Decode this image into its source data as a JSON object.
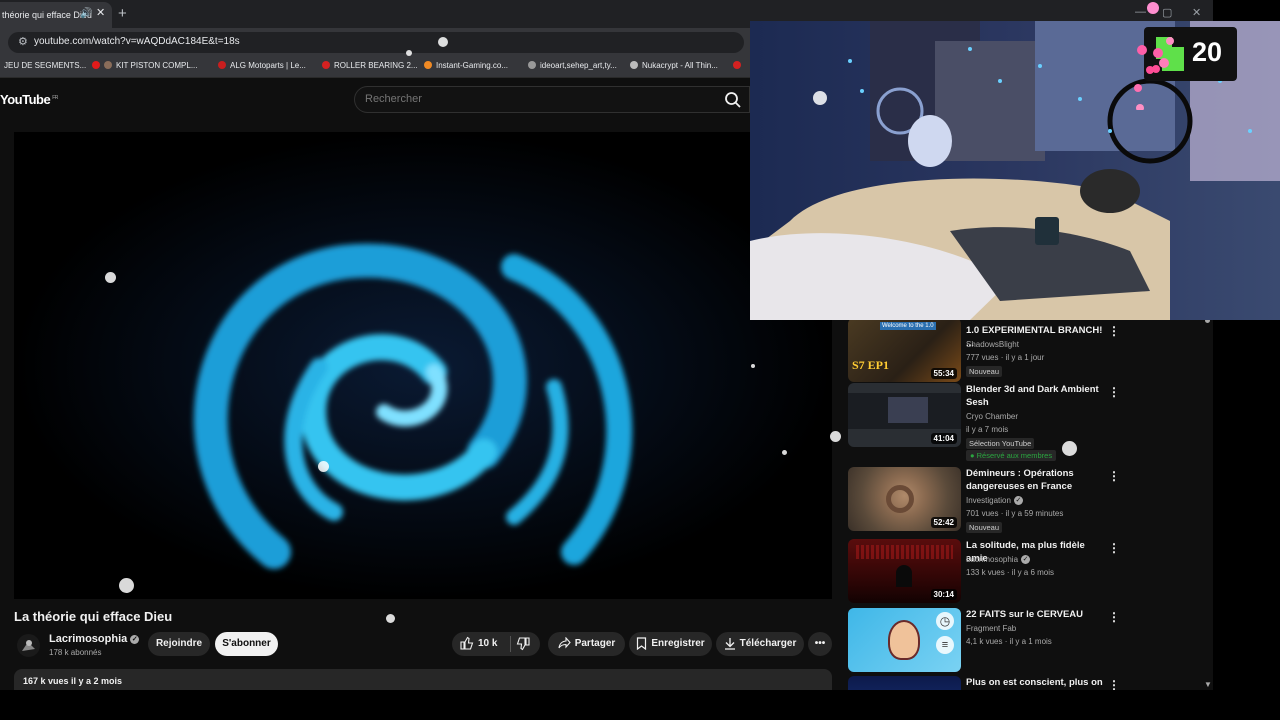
{
  "browser": {
    "tab_title": "théorie qui efface Dieu",
    "url": "youtube.com/watch?v=wAQDdAC184E&t=18s",
    "bookmarks": [
      "JEU DE SEGMENTS...",
      "KIT PISTON COMPL...",
      "ALG Motoparts | Le...",
      "ROLLER BEARING 2...",
      "Instant-Gaming.co...",
      "ideoart,sehep_art,ty...",
      "Nukacrypt - All Thin..."
    ]
  },
  "youtube": {
    "logo": "YouTube",
    "logo_region": "FR",
    "search_placeholder": "Rechercher",
    "video": {
      "title": "La théorie qui efface Dieu",
      "channel": "Lacrimosophia",
      "subscribers": "178 k abonnés",
      "join_label": "Rejoindre",
      "subscribe_label": "S'abonner",
      "likes": "10 k",
      "share_label": "Partager",
      "save_label": "Enregistrer",
      "download_label": "Télécharger",
      "views_date": "167 k vues  il y a 2 mois"
    },
    "recommendations": [
      {
        "title": "1.0 EXPERIMENTAL BRANCH! ...",
        "channel": "ShadowsBlight",
        "meta": "777 vues · il y a 1 jour",
        "badge": "Nouveau",
        "duration": "55:34",
        "thumb_text": "S7 EP1"
      },
      {
        "title": "Blender 3d and Dark Ambient Sesh",
        "channel": "Cryo Chamber",
        "meta": "il y a 7 mois",
        "badge": "Sélection YouTube",
        "members": "Réservé aux membres",
        "duration": "41:04"
      },
      {
        "title": "Démineurs : Opérations dangereuses en France",
        "channel": "Investigation",
        "meta": "701 vues · il y a 59 minutes",
        "badge": "Nouveau",
        "duration": "52:42"
      },
      {
        "title": "La solitude, ma plus fidèle amie",
        "channel": "Lacrimosophia",
        "meta": "133 k vues · il y a 6 mois",
        "duration": "30:14"
      },
      {
        "title": "22 FAITS sur le CERVEAU",
        "channel": "Fragment Fab",
        "meta": "4,1 k vues · il y a 1 mois"
      },
      {
        "title": "Plus on est conscient, plus on"
      }
    ]
  },
  "overlay": {
    "counter_value": "20"
  },
  "colors": {
    "yt_bg": "#0f0f0f",
    "swirl": "#2bb5e8",
    "members_green": "#2ba640"
  }
}
